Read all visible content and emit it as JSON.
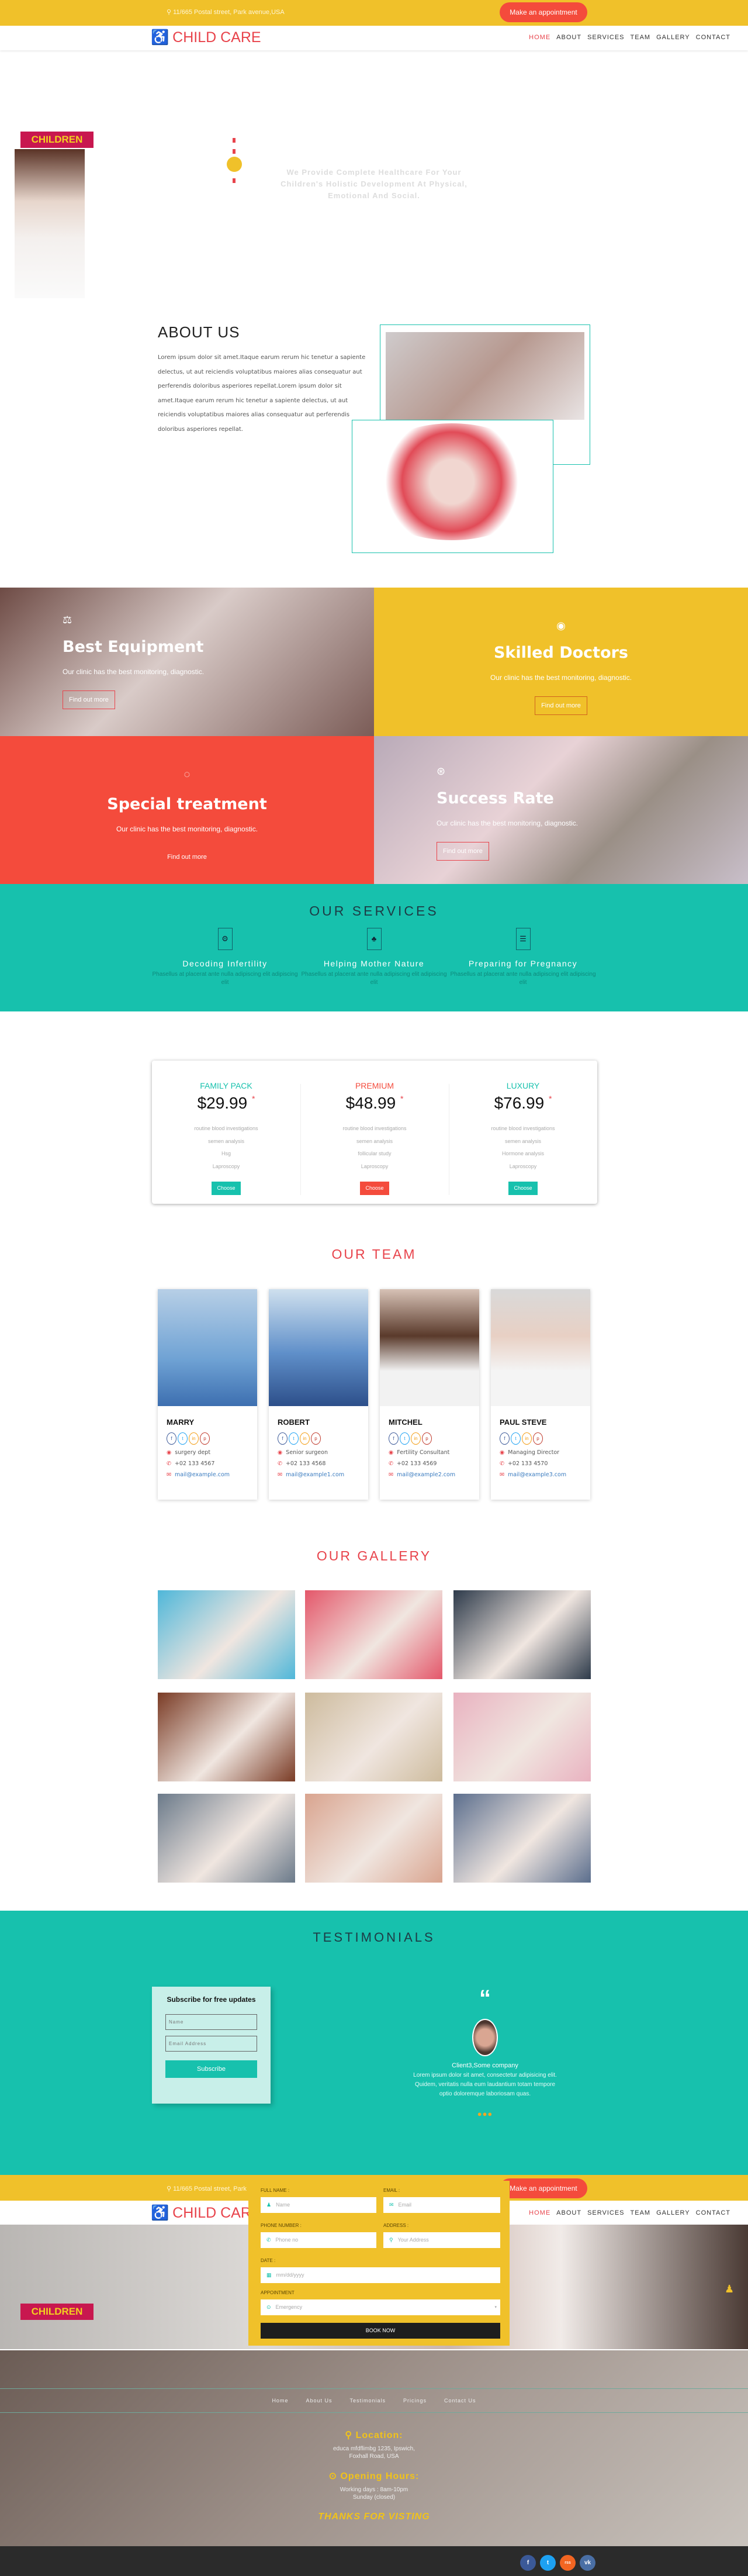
{
  "header": {
    "address": "11/665 Postal street, Park avenue,USA",
    "appointment_button": "Make an appointment",
    "logo": "CHILD CARE",
    "menu": [
      "HOME",
      "ABOUT",
      "SERVICES",
      "TEAM",
      "GALLERY",
      "CONTACT"
    ]
  },
  "hero": {
    "badge": "CHILDREN",
    "tagline": "We Provide Complete Healthcare For Your Children's Holistic Development At Physical, Emotional And Social."
  },
  "about": {
    "title": "ABOUT US",
    "text": "Lorem ipsum dolor sit amet.Itaque earum rerum hic tenetur a sapiente delectus, ut aut reiciendis voluptatibus maiores alias consequatur aut perferendis doloribus asperiores repellat.Lorem ipsum dolor sit amet.Itaque earum rerum hic tenetur a sapiente delectus, ut aut reiciendis voluptatibus maiores alias consequatur aut perferendis doloribus asperiores repellat."
  },
  "features": [
    {
      "title": "Best Equipment",
      "text": "Our clinic has the best monitoring, diagnostic.",
      "button": "Find out more",
      "icon": "scales-icon"
    },
    {
      "title": "Skilled Doctors",
      "text": "Our clinic has the best monitoring, diagnostic.",
      "button": "Find out more",
      "icon": "user-icon"
    },
    {
      "title": "Special treatment",
      "text": "Our clinic has the best monitoring, diagnostic.",
      "button": "Find out more",
      "icon": "spinner-icon"
    },
    {
      "title": "Success Rate",
      "text": "Our clinic has the best monitoring, diagnostic.",
      "button": "Find out more",
      "icon": "handshake-icon"
    }
  ],
  "services": {
    "title": "OUR SERVICES",
    "items": [
      {
        "title": "Decoding Infertility",
        "text": "Phasellus at placerat ante nulla adipiscing elit adipiscing elit",
        "icon": "gears-icon"
      },
      {
        "title": "Helping Mother Nature",
        "text": "Phasellus at placerat ante nulla adipiscing elit adipiscing elit",
        "icon": "users-icon"
      },
      {
        "title": "Preparing for Pregnancy",
        "text": "Phasellus at placerat ante nulla adipiscing elit adipiscing elit",
        "icon": "list-icon"
      }
    ]
  },
  "pricing": [
    {
      "name": "FAMILY PACK",
      "price": "$29.99",
      "star": "*",
      "features": [
        "routine blood investigations",
        "semen analysis",
        "Hsg",
        "Laproscopy"
      ],
      "button": "Choose Plan",
      "color": "#17c1ad"
    },
    {
      "name": "PREMIUM",
      "price": "$48.99",
      "star": "*",
      "features": [
        "routine blood investigations",
        "semen analysis",
        "follicular study",
        "Laproscopy"
      ],
      "button": "Choose Plan",
      "color": "#f44b3c"
    },
    {
      "name": "LUXURY",
      "price": "$76.99",
      "star": "*",
      "features": [
        "routine blood investigations",
        "semen analysis",
        "Hormone analysis",
        "Laproscopy"
      ],
      "button": "Choose Plan",
      "color": "#17c1ad"
    }
  ],
  "team": {
    "title": "OUR TEAM",
    "members": [
      {
        "name": "MARRY",
        "role": "surgery dept",
        "phone": "+02 133 4567",
        "email": "mail@example.com"
      },
      {
        "name": "ROBERT",
        "role": "Senior surgeon",
        "phone": "+02 133 4568",
        "email": "mail@example1.com"
      },
      {
        "name": "MITCHEL",
        "role": "Fertility Consultant",
        "phone": "+02 133 4569",
        "email": "mail@example2.com"
      },
      {
        "name": "PAUL STEVE",
        "role": "Managing Director",
        "phone": "+02 133 4570",
        "email": "mail@example3.com"
      }
    ],
    "social": [
      "f",
      "t",
      "in",
      "p"
    ]
  },
  "gallery": {
    "title": "OUR GALLERY"
  },
  "testimonials": {
    "title": "TESTIMONIALS",
    "subscribe_title": "Subscribe for free updates",
    "name_placeholder": "Name",
    "email_placeholder": "Email Address",
    "subscribe_button": "Subscribe",
    "quote_mark": "“",
    "client": "Client3,Some company",
    "text": "Lorem ipsum dolor sit amet, consectetur adipisicing elit. Quidem, veritatis nulla eum laudantium totam tempore optio doloremque laboriosam quas."
  },
  "booking": {
    "full_name_label": "FULL NAME :",
    "name_placeholder": "Name",
    "email_label": "EMAIL :",
    "email_placeholder": "Email",
    "phone_label": "PHONE NUMBER :",
    "phone_placeholder": "Phone no",
    "address_label": "ADDRESS :",
    "address_placeholder": "Your Address",
    "date_label": "DATE :",
    "date_placeholder": "mm/dd/yyyy",
    "appointment_label": "APPOINTMENT",
    "appointment_value": "Emergency",
    "button": "BOOK NOW"
  },
  "footer": {
    "links": [
      "Home",
      "About Us",
      "Testimonials",
      "Pricings",
      "Contact Us"
    ],
    "location_title": "Location:",
    "location_line1": "educa mfdflimbg 1235, Ipswich,",
    "location_line2": "Foxhall Road, USA",
    "hours_title": "Opening Hours:",
    "hours_line1": "Working days : 8am-10pm",
    "hours_line2": "Sunday (closed)",
    "thanks": "THANKS FOR VISTING",
    "social": [
      "f",
      "t",
      "rss",
      "vk"
    ]
  },
  "colors": {
    "yellow": "#f0c12a",
    "red": "#f44b3c",
    "teal": "#17c1ad"
  }
}
